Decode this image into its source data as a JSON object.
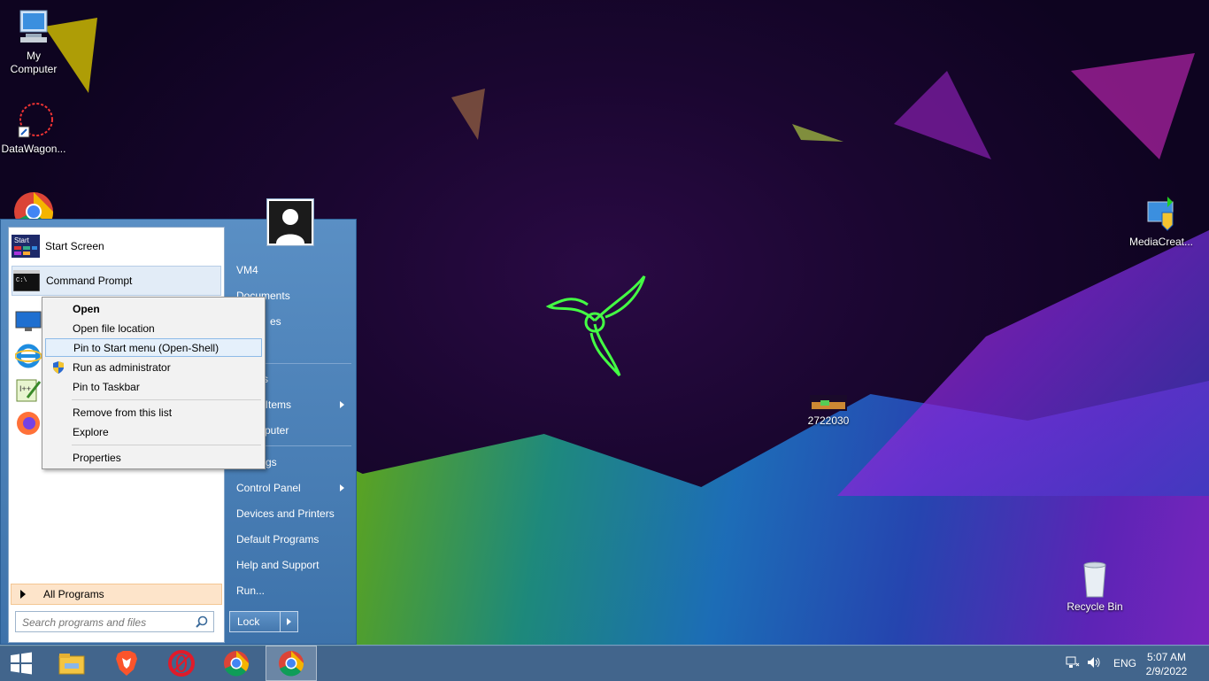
{
  "desktop": {
    "icons": [
      {
        "label": "My\nComputer",
        "name": "my-computer"
      },
      {
        "label": "DataWagon...",
        "name": "datawagon"
      },
      {
        "label": "MediaCreat...",
        "name": "mediacreation"
      },
      {
        "label": "2722030",
        "name": "2722030"
      },
      {
        "label": "Recycle Bin",
        "name": "recycle-bin"
      }
    ]
  },
  "start_menu": {
    "pinned": [
      {
        "label": "Start Screen",
        "icon": "start-screen-icon"
      },
      {
        "label": "Command Prompt",
        "icon": "command-prompt-icon"
      }
    ],
    "recent_icons": [
      "monitor-icon",
      "internet-explorer-icon",
      "notepad-plus-plus-icon",
      "firefox-icon"
    ],
    "all_programs_label": "All Programs",
    "search_placeholder": "Search programs and files",
    "right_items": [
      {
        "label": "VM4",
        "arrow": false
      },
      {
        "label": "Documents",
        "arrow": false
      },
      {
        "label": "es",
        "arrow": false
      },
      {
        "label": "s",
        "arrow": false
      },
      {
        "label": "t Items",
        "arrow": true
      },
      {
        "label": "mputer",
        "arrow": false
      },
      {
        "label": "gs",
        "arrow": false
      },
      {
        "label": "Control Panel",
        "arrow": true
      },
      {
        "label": "Devices and Printers",
        "arrow": false
      },
      {
        "label": "Default Programs",
        "arrow": false
      },
      {
        "label": "Help and Support",
        "arrow": false
      },
      {
        "label": "Run...",
        "arrow": false
      }
    ],
    "lock_label": "Lock"
  },
  "context_menu": {
    "items": [
      {
        "label": "Open",
        "bold": true,
        "highlighted": false
      },
      {
        "label": "Open file location",
        "bold": false,
        "highlighted": false
      },
      {
        "label": "Pin to Start menu (Open-Shell)",
        "bold": false,
        "highlighted": true
      },
      {
        "label": "Run as administrator",
        "bold": false,
        "highlighted": false
      },
      {
        "label": "Pin to Taskbar",
        "bold": false,
        "highlighted": false
      },
      {
        "label": "Remove from this list",
        "bold": false,
        "highlighted": false
      },
      {
        "label": "Explore",
        "bold": false,
        "highlighted": false
      },
      {
        "label": "Properties",
        "bold": false,
        "highlighted": false
      }
    ]
  },
  "taskbar": {
    "apps": [
      "windows-start-icon",
      "file-explorer-icon",
      "brave-icon",
      "opera-icon",
      "chrome-icon",
      "chrome-active-icon"
    ],
    "language": "ENG",
    "time": "5:07 AM",
    "date": "2/9/2022"
  },
  "colors": {
    "start_menu_bg": "#4a80b8",
    "context_highlight": "#e5f0fb",
    "all_programs_bg": "#fde4ca"
  }
}
